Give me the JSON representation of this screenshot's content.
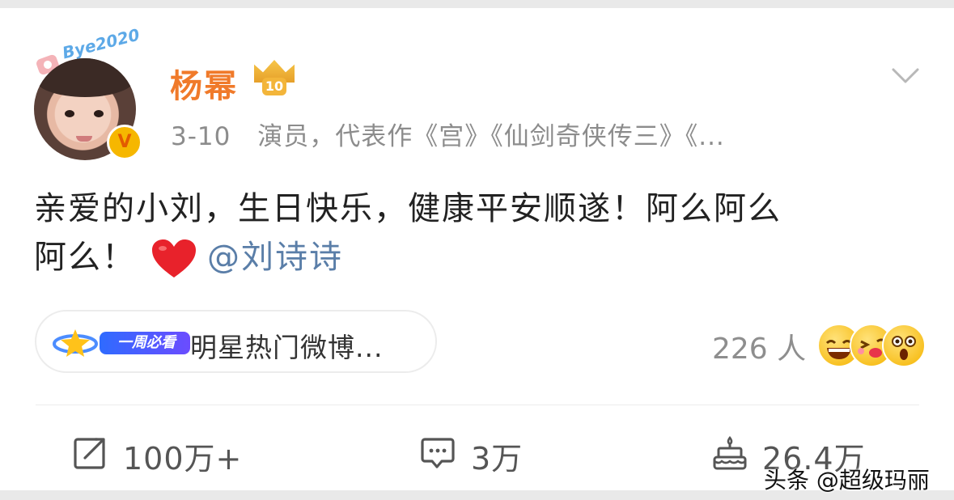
{
  "post": {
    "author": {
      "name": "杨幂",
      "avatar_badge_text": "Bye2020",
      "vip_level": "10",
      "verified_mark": "V"
    },
    "meta": {
      "date": "3-10",
      "description": "演员，代表作《宫》《仙剑奇侠传三》《..."
    },
    "text": {
      "line1": "亲爱的小刘，生日快乐，健康平安顺遂！阿么阿么",
      "line2": "阿么！",
      "mention": "@刘诗诗"
    },
    "topic": {
      "tag_label": "一周必看",
      "title": "明星热门微博..."
    },
    "reactions": {
      "count_text": "226 人",
      "emoji_names": [
        "grinning-emoji",
        "kiss-emoji",
        "surprised-emoji"
      ]
    },
    "actions": {
      "repost": "100万+",
      "comment": "3万",
      "like": "26.4万"
    }
  },
  "watermark": "头条 @超级玛丽",
  "colors": {
    "username": "#f07a2a",
    "mention": "#5a7ea8",
    "meta": "#8c8c8c",
    "heart": "#e8222b"
  }
}
